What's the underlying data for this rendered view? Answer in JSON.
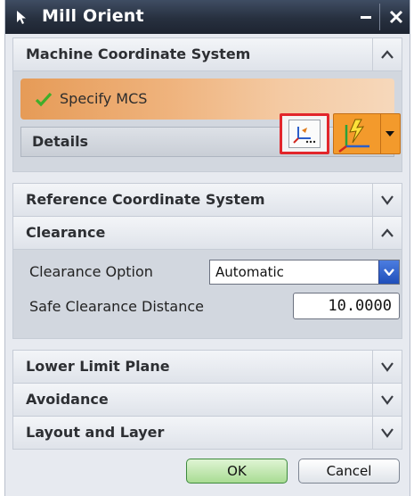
{
  "window": {
    "title": "Mill Orient"
  },
  "groups": {
    "mcs": {
      "label": "Machine Coordinate System",
      "specify_label": "Specify MCS",
      "details_label": "Details"
    },
    "reference": {
      "label": "Reference Coordinate System"
    },
    "clearance": {
      "label": "Clearance",
      "option_label": "Clearance Option",
      "option_value": "Automatic",
      "distance_label": "Safe Clearance Distance",
      "distance_value": "10.0000"
    },
    "lower_limit": {
      "label": "Lower Limit Plane"
    },
    "avoidance": {
      "label": "Avoidance"
    },
    "layout": {
      "label": "Layout and Layer"
    }
  },
  "buttons": {
    "ok": "OK",
    "cancel": "Cancel"
  },
  "icons": {
    "title": "select-arrow-icon",
    "minimize": "minimize-icon",
    "close": "close-icon",
    "check": "checkmark-icon",
    "csys_dialog": "csys-dialog-icon",
    "csys_auto": "csys-lightning-icon"
  },
  "colors": {
    "accent_orange": "#f39a2c",
    "highlight_red": "#e2262b",
    "check_green": "#3fae2a",
    "ok_green": "#a9dc93",
    "select_blue": "#2f62cf"
  }
}
